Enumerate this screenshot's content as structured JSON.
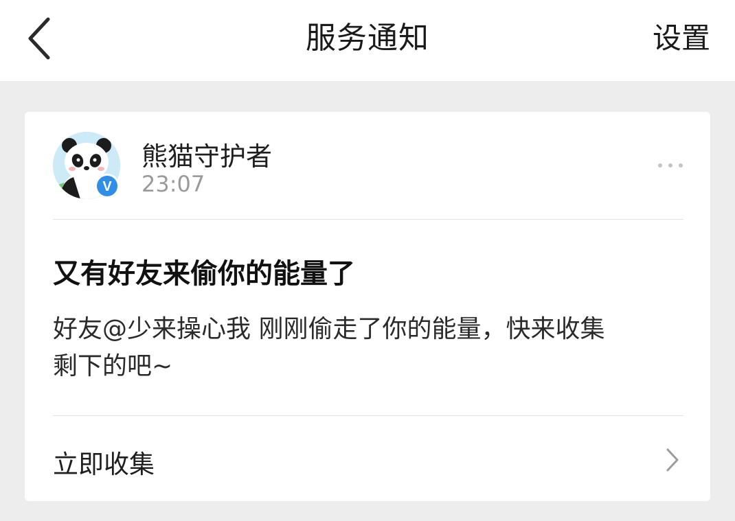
{
  "header": {
    "back_icon": "chevron-left-icon",
    "title": "服务通知",
    "settings_label": "设置"
  },
  "notification": {
    "sender": {
      "name": "熊猫守护者",
      "time": "23:07",
      "avatar_icon": "panda-avatar",
      "badge_icon": "verified-v-icon",
      "badge_letter": "V"
    },
    "more_icon": "more-dots-icon",
    "title": "又有好友来偷你的能量了",
    "body_lines": [
      "好友@少来操心我  刚刚偷走了你的能量，快来收集",
      "剩下的吧~"
    ],
    "action": {
      "label": "立即收集",
      "icon": "chevron-right-icon"
    }
  },
  "colors": {
    "background": "#ededed",
    "card": "#ffffff",
    "verified_badge": "#2f8fe8",
    "muted_text": "#9a9a9a"
  }
}
